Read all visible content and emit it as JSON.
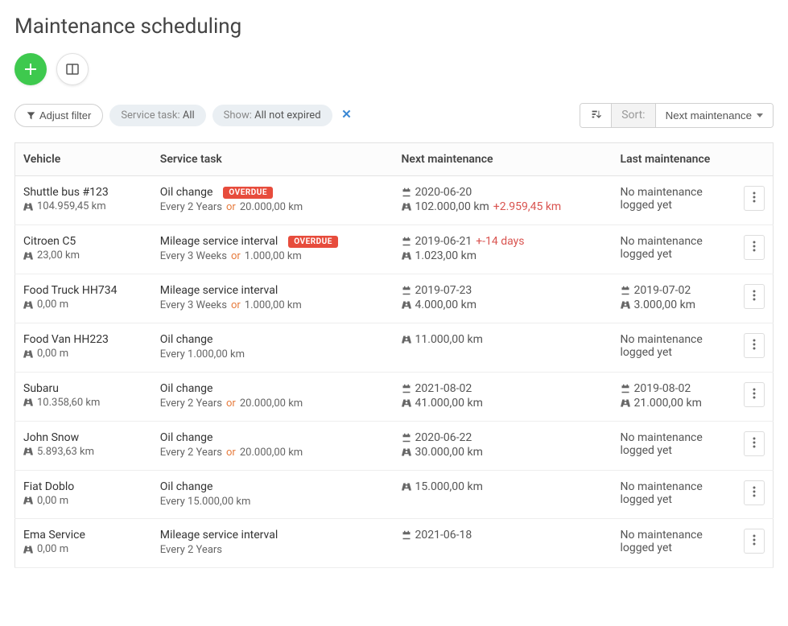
{
  "page_title": "Maintenance scheduling",
  "filter": {
    "adjust_label": "Adjust filter",
    "chip1_label": "Service task:",
    "chip1_value": "All",
    "chip2_label": "Show:",
    "chip2_value": "All not expired"
  },
  "sort": {
    "label": "Sort:",
    "value": "Next maintenance"
  },
  "columns": {
    "vehicle": "Vehicle",
    "service_task": "Service task",
    "next": "Next maintenance",
    "last": "Last maintenance"
  },
  "labels": {
    "overdue": "OVERDUE",
    "or": "or",
    "no_maintenance": "No maintenance logged yet"
  },
  "rows": [
    {
      "vehicle": "Shuttle bus #123",
      "odometer": "104.959,45 km",
      "task": "Oil change",
      "overdue": true,
      "interval_a": "Every 2 Years",
      "interval_or": true,
      "interval_b": "20.000,00 km",
      "next_date": "2020-06-20",
      "next_km": "102.000,00 km",
      "next_over": "+2.959,45 km",
      "last_date": "",
      "last_km": "",
      "last_none": true
    },
    {
      "vehicle": "Citroen C5",
      "odometer": "23,00 km",
      "task": "Mileage service interval",
      "overdue": true,
      "interval_a": "Every 3 Weeks",
      "interval_or": true,
      "interval_b": "1.000,00 km",
      "next_date": "2019-06-21",
      "next_date_over": "+-14 days",
      "next_km": "1.023,00 km",
      "last_none": true
    },
    {
      "vehicle": "Food Truck HH734",
      "odometer": "0,00 m",
      "task": "Mileage service interval",
      "interval_a": "Every 3 Weeks",
      "interval_or": true,
      "interval_b": "1.000,00 km",
      "next_date": "2019-07-23",
      "next_km": "4.000,00 km",
      "last_date": "2019-07-02",
      "last_km": "3.000,00 km"
    },
    {
      "vehicle": "Food Van HH223",
      "odometer": "0,00 m",
      "task": "Oil change",
      "interval_a": "Every 1.000,00 km",
      "next_km": "11.000,00 km",
      "last_none": true
    },
    {
      "vehicle": "Subaru",
      "odometer": "10.358,60 km",
      "task": "Oil change",
      "interval_a": "Every 2 Years",
      "interval_or": true,
      "interval_b": "20.000,00 km",
      "next_date": "2021-08-02",
      "next_km": "41.000,00 km",
      "last_date": "2019-08-02",
      "last_km": "21.000,00 km"
    },
    {
      "vehicle": "John Snow",
      "odometer": "5.893,63 km",
      "task": "Oil change",
      "interval_a": "Every 2 Years",
      "interval_or": true,
      "interval_b": "20.000,00 km",
      "next_date": "2020-06-22",
      "next_km": "30.000,00 km",
      "last_none": true
    },
    {
      "vehicle": "Fiat Doblo",
      "odometer": "0,00 m",
      "task": "Oil change",
      "interval_a": "Every 15.000,00 km",
      "next_km": "15.000,00 km",
      "last_none": true
    },
    {
      "vehicle": "Ema Service",
      "odometer": "0,00 m",
      "task": "Mileage service interval",
      "interval_a": "Every 2 Years",
      "next_date": "2021-06-18",
      "last_none": true
    }
  ]
}
